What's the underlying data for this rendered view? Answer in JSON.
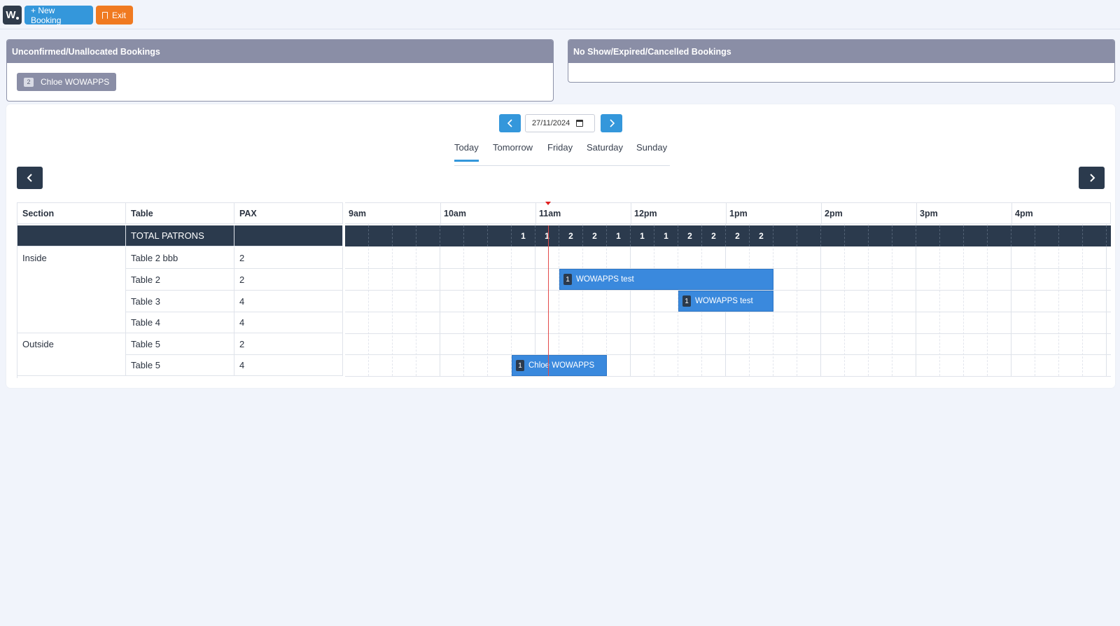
{
  "topbar": {
    "logo_text": "W",
    "new_booking": "+ New Booking",
    "exit": "Exit"
  },
  "panels": {
    "unconfirmed_title": "Unconfirmed/Unallocated Bookings",
    "unconfirmed_items": [
      {
        "count": "2",
        "name": "Chloe WOWAPPS"
      }
    ],
    "noshow_title": "No Show/Expired/Cancelled Bookings"
  },
  "date_nav": {
    "date_value": "27/11/2024",
    "prev_icon": "chevron-left-icon",
    "next_icon": "chevron-right-icon"
  },
  "day_tabs": [
    "Today",
    "Tomorrow",
    "Friday",
    "Saturday",
    "Sunday"
  ],
  "day_tabs_active": "Today",
  "grid": {
    "headers": {
      "section": "Section",
      "table": "Table",
      "pax": "PAX"
    },
    "hours": [
      "9am",
      "10am",
      "11am",
      "12pm",
      "1pm",
      "2pm",
      "3pm",
      "4pm"
    ],
    "totals_label": "TOTAL PATRONS",
    "totals": [
      "",
      "",
      "",
      "",
      "",
      "",
      "",
      "1",
      "1",
      "2",
      "2",
      "1",
      "1",
      "1",
      "2",
      "2",
      "2",
      "2",
      "",
      "",
      "",
      "",
      "",
      "",
      "",
      "",
      "",
      "",
      "",
      "",
      "",
      ""
    ],
    "rows": [
      {
        "section": "Inside",
        "table": "Table 2 bbb",
        "pax": "2"
      },
      {
        "section": "",
        "table": "Table 2",
        "pax": "2"
      },
      {
        "section": "",
        "table": "Table 3",
        "pax": "4"
      },
      {
        "section": "",
        "table": "Table 4",
        "pax": "4"
      },
      {
        "section": "Outside",
        "table": "Table 5",
        "pax": "2"
      },
      {
        "section": "",
        "table": "Table 5",
        "pax": "4"
      }
    ],
    "bookings": [
      {
        "row": 1,
        "count": "1",
        "name": "WOWAPPS test",
        "start": "11:15am",
        "end": "1:30pm"
      },
      {
        "row": 2,
        "count": "1",
        "name": "WOWAPPS test",
        "start": "12:30pm",
        "end": "1:30pm"
      },
      {
        "row": 5,
        "count": "1",
        "name": "Chloe WOWAPPS",
        "start": "10:45am",
        "end": "11:45am"
      }
    ],
    "current_time": "11:08am"
  },
  "colors": {
    "primary": "#3497db",
    "exit": "#f07a21",
    "panel_header": "#8a8ea6",
    "dark": "#2b3a4d",
    "booking": "#3a89dd",
    "now_line": "#e34b4b"
  }
}
